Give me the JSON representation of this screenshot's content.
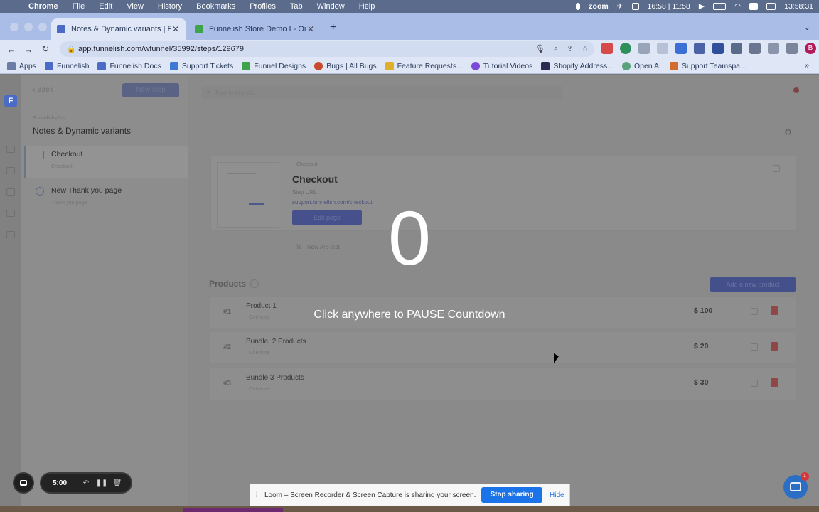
{
  "menubar": {
    "app": "Chrome",
    "items": [
      "File",
      "Edit",
      "View",
      "History",
      "Bookmarks",
      "Profiles",
      "Tab",
      "Window",
      "Help"
    ],
    "zoom": "zoom",
    "clock_world": "16:58 | 11:58",
    "datetime": "13:58:31"
  },
  "tabs": [
    {
      "title": "Notes & Dynamic variants | Fu",
      "color": "#4a6bc6"
    },
    {
      "title": "Funnelish Store Demo I - Orde",
      "color": "#3fa34d"
    }
  ],
  "toolbar": {
    "url": "app.funnelish.com/wfunnel/35992/steps/129679",
    "profile_initial": "B"
  },
  "bookmarks": [
    {
      "label": "Apps",
      "color": "#6b7da6"
    },
    {
      "label": "Funnelish",
      "color": "#4a6bc6"
    },
    {
      "label": "Funnelish Docs",
      "color": "#4a6bc6"
    },
    {
      "label": "Support Tickets",
      "color": "#3b7bd6"
    },
    {
      "label": "Funnel Designs",
      "color": "#3fa34d"
    },
    {
      "label": "Bugs | All Bugs",
      "color": "#c84b2f"
    },
    {
      "label": "Feature Requests...",
      "color": "#e0b02a"
    },
    {
      "label": "Tutorial Videos",
      "color": "#7b4ad6"
    },
    {
      "label": "Shopify Address...",
      "color": "#2b2b4f"
    },
    {
      "label": "Open AI",
      "color": "#5aa37a"
    },
    {
      "label": "Support Teamspa...",
      "color": "#d36b2f"
    }
  ],
  "sidebar": {
    "back": "Back",
    "new_step": "New step",
    "project": "Funnelish plus",
    "funnel_title": "Notes & Dynamic variants",
    "steps": [
      {
        "name": "Checkout",
        "sub": "Checkout"
      },
      {
        "name": "New Thank you page",
        "sub": "Thank you page"
      }
    ]
  },
  "main": {
    "search_placeholder": "Type to search...",
    "step": {
      "tag": "Checkout",
      "title": "Checkout",
      "url_label": "Step URL",
      "url": "support.funnelish.com/checkout",
      "edit": "Edit page",
      "ab_test": "New A/B test"
    },
    "products_heading": "Products",
    "add_product": "Add a new product",
    "products": [
      {
        "num": "#1",
        "name": "Product 1",
        "type": "One-time",
        "price": "$ 100"
      },
      {
        "num": "#2",
        "name": "Bundle: 2 Products",
        "type": "One-time",
        "price": "$ 20"
      },
      {
        "num": "#3",
        "name": "Bundle 3 Products",
        "type": "One-time",
        "price": "$ 30"
      }
    ]
  },
  "overlay": {
    "countdown": "0",
    "hint": "Click anywhere to PAUSE Countdown"
  },
  "recorder": {
    "time": "5:00"
  },
  "share_banner": {
    "message": "Loom – Screen Recorder & Screen Capture is sharing your screen.",
    "stop": "Stop sharing",
    "hide": "Hide"
  },
  "chat_badge": "1"
}
